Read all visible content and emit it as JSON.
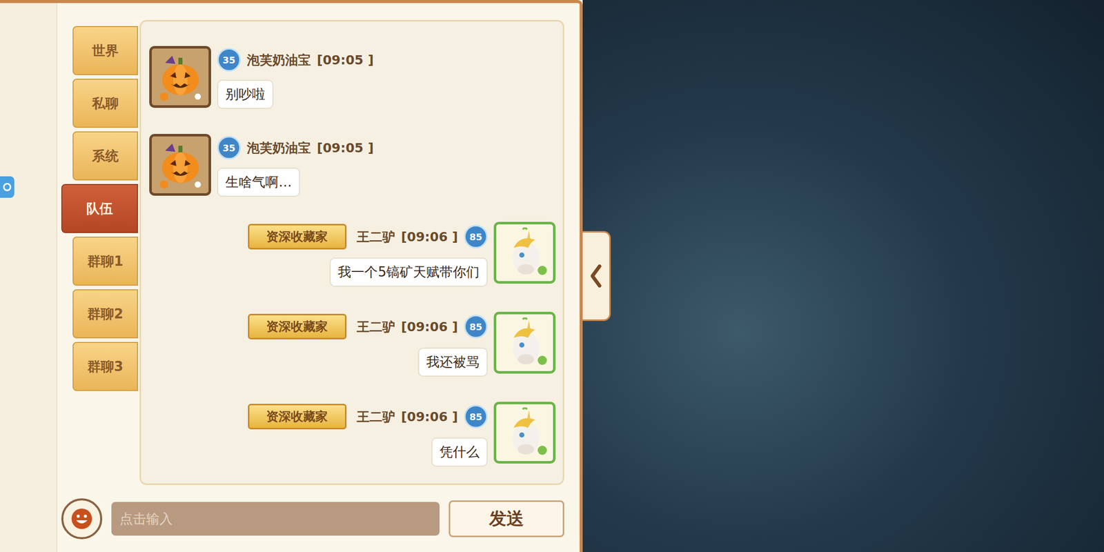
{
  "tabs": [
    {
      "label": "世界",
      "selected": false
    },
    {
      "label": "私聊",
      "selected": false
    },
    {
      "label": "系统",
      "selected": false
    },
    {
      "label": "队伍",
      "selected": true
    },
    {
      "label": "群聊1",
      "selected": false
    },
    {
      "label": "群聊2",
      "selected": false
    },
    {
      "label": "群聊3",
      "selected": false
    }
  ],
  "messages": [
    {
      "kind": "other",
      "level": "35",
      "name": "泡芙奶油宝",
      "time": "[09:05 ]",
      "text": "别吵啦"
    },
    {
      "kind": "other",
      "level": "35",
      "name": "泡芙奶油宝",
      "time": "[09:05 ]",
      "text": "生啥气啊…"
    },
    {
      "kind": "self",
      "title": "资深收藏家",
      "level": "85",
      "name": "王二驴",
      "time": "[09:06 ]",
      "text": "我一个5镐矿天赋带你们"
    },
    {
      "kind": "self",
      "title": "资深收藏家",
      "level": "85",
      "name": "王二驴",
      "time": "[09:06 ]",
      "text": "我还被骂"
    },
    {
      "kind": "self",
      "title": "资深收藏家",
      "level": "85",
      "name": "王二驴",
      "time": "[09:06 ]",
      "text": "凭什么"
    }
  ],
  "input": {
    "placeholder": "点击输入"
  },
  "send_button": "发送"
}
